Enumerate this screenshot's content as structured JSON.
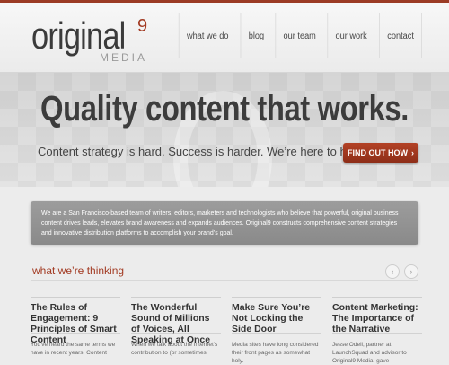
{
  "brand": {
    "word": "original",
    "superscript": "9",
    "sub": "MEDIA",
    "accent": "#a23a22"
  },
  "nav": {
    "items": [
      "what we do",
      "blog",
      "our team",
      "our work",
      "contact"
    ]
  },
  "hero": {
    "title": "Quality content that works.",
    "tagline": "Content strategy is hard. Success is harder. We’re here to help.",
    "cta_label": "FIND OUT HOW",
    "cta_icon": "chevron-right-icon"
  },
  "about": {
    "text": "We are a San Francisco-based team of writers, editors, marketers and technologists who believe that powerful, original business content drives leads, elevates brand awareness and expands audiences. Original9 constructs comprehensive content strategies and innovative distribution platforms to accomplish your brand’s goal."
  },
  "thinking": {
    "title": "what we’re thinking",
    "prev_icon": "chevron-left-icon",
    "next_icon": "chevron-right-icon",
    "posts": [
      {
        "title": "The Rules of Engagement: 9 Principles of Smart Content",
        "excerpt": "You've heard the same terms we have in recent years: Content"
      },
      {
        "title": "The Wonderful Sound of Millions of Voices, All Speaking at Once",
        "excerpt": "When we talk about the Internet's contribution to (or sometimes"
      },
      {
        "title": "Make Sure You’re Not Locking the Side Door",
        "excerpt": "Media sites have long considered their front pages as somewhat holy."
      },
      {
        "title": "Content Marketing: The Importance of the Narrative",
        "excerpt": "Jesse Odell, partner at LaunchSquad and advisor to Original9 Media, gave"
      }
    ]
  }
}
